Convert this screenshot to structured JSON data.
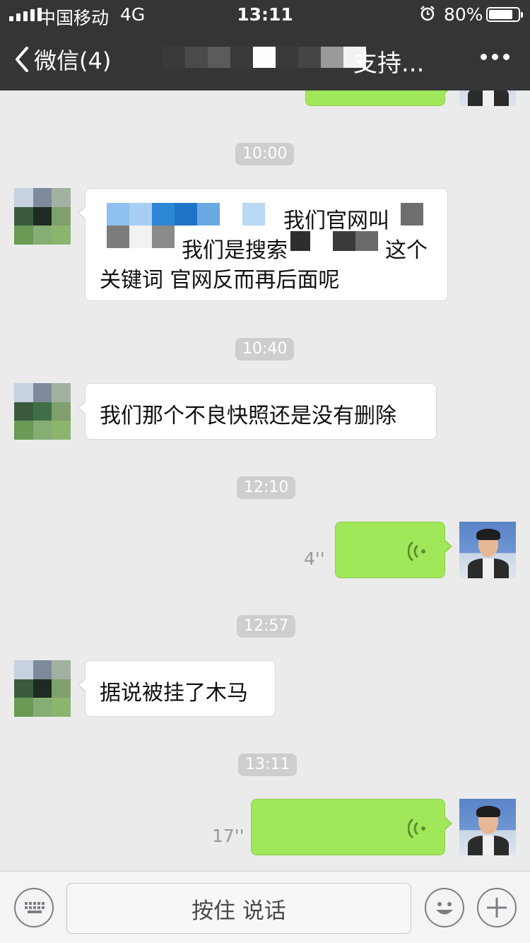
{
  "status_bar": {
    "carrier": "中国移动",
    "network": "4G",
    "time": "13:11",
    "battery_percent": "80%",
    "battery_level": 0.8
  },
  "nav": {
    "back_label": "微信(4)",
    "title_visible": "支持..."
  },
  "messages": [
    {
      "time": "10:00"
    },
    {
      "from": "contact",
      "text": [
        "我们官网叫",
        "我们是搜索",
        "这个",
        "关键词  官网反而再后面呢"
      ]
    },
    {
      "time": "10:40"
    },
    {
      "from": "contact",
      "text": [
        "我们那个不良快照还是没有删除"
      ]
    },
    {
      "time": "12:10"
    },
    {
      "from": "me",
      "type": "voice",
      "duration": "4''"
    },
    {
      "time": "12:57"
    },
    {
      "from": "contact",
      "text": [
        "据说被挂了木马"
      ]
    },
    {
      "time": "13:11"
    },
    {
      "from": "me",
      "type": "voice",
      "duration": "17''"
    }
  ],
  "input_bar": {
    "hold_to_talk": "按住 说话"
  },
  "colors": {
    "header": "#353535",
    "chat_background": "#ebebeb",
    "my_bubble": "#a0e759",
    "time_label": "#cecece"
  },
  "icons": [
    "back-arrow-icon",
    "more-icon",
    "alarm-icon",
    "battery-icon",
    "voice-icon",
    "keyboard-icon",
    "emoji-icon",
    "plus-icon"
  ]
}
